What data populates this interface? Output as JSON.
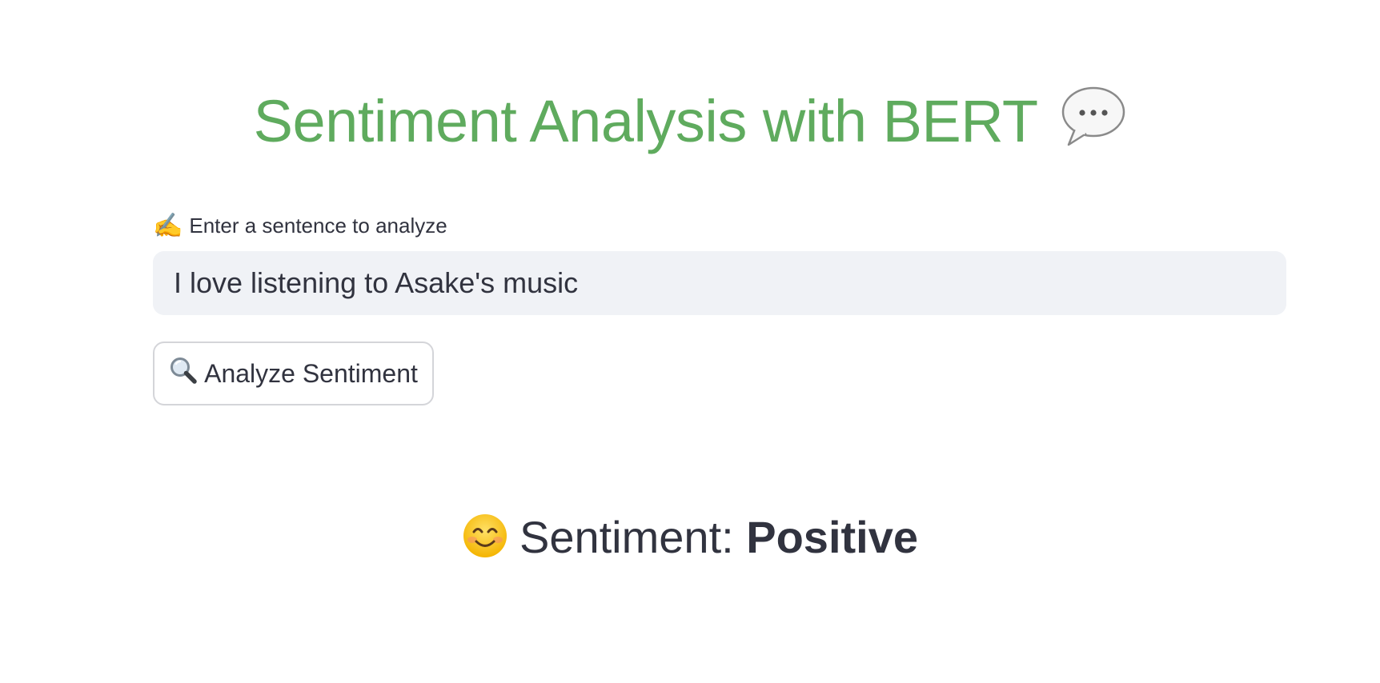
{
  "header": {
    "title": "Sentiment Analysis with BERT",
    "title_icon": "speech-balloon-icon",
    "title_color": "#5fab5e"
  },
  "input": {
    "label_icon": "✍️",
    "label": "Enter a sentence to analyze",
    "value": "I love listening to Asake's music"
  },
  "button": {
    "icon": "magnifying-glass-icon",
    "label": "Analyze Sentiment"
  },
  "result": {
    "icon": "smiling-face-icon",
    "prefix": "Sentiment:",
    "value": "Positive"
  }
}
